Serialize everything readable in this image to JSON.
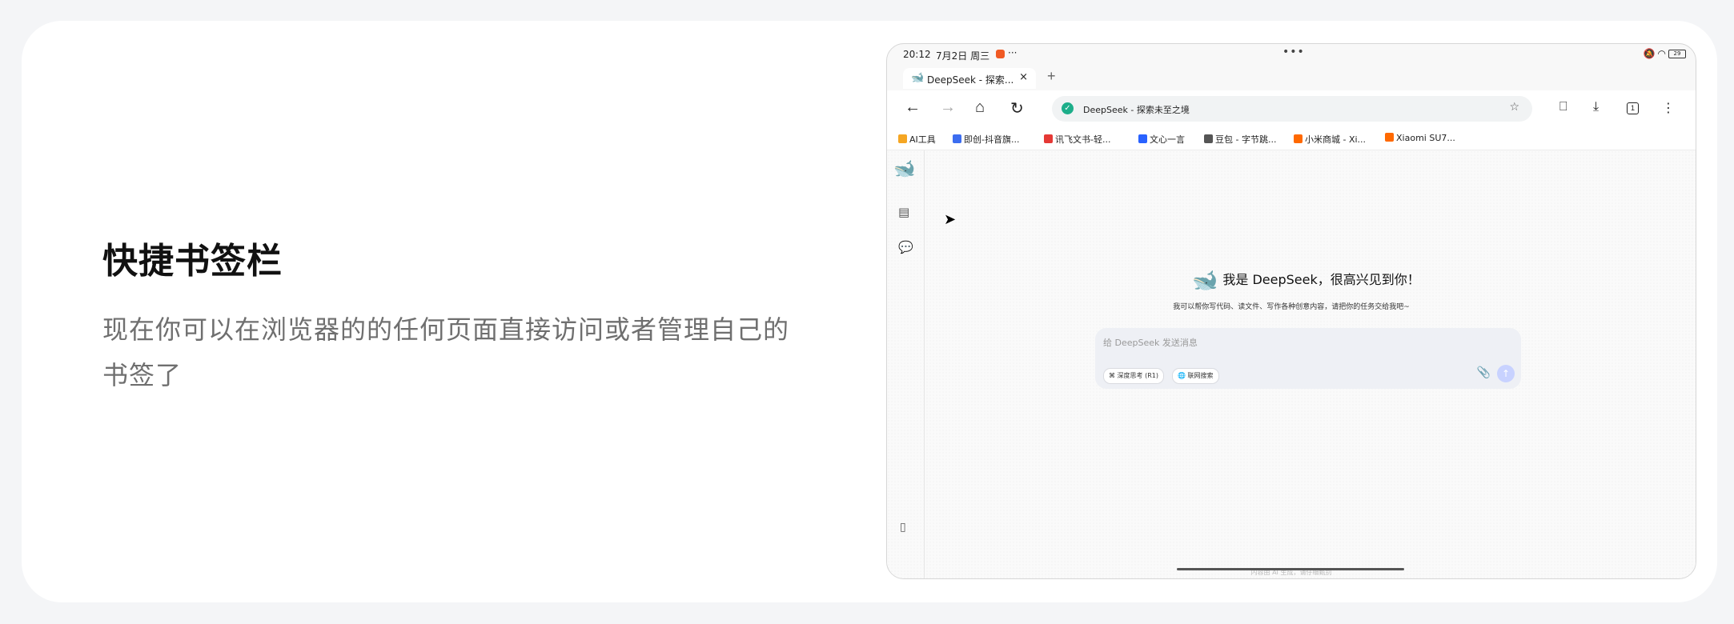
{
  "feature": {
    "title": "快捷书签栏",
    "description_line1": "现在你可以在浏览器的的任何页面直接访问或者管理自己的",
    "description_line2": "书签了"
  },
  "statusbar": {
    "time": "20:12",
    "date": "7月2日 周三",
    "more": "···",
    "center_dots": "•••",
    "battery": "29"
  },
  "tab": {
    "favicon": "deepseek-icon",
    "label": "DeepSeek - 探索...",
    "close": "×",
    "new_tab": "+"
  },
  "navbar": {
    "back": "←",
    "forward": "→",
    "home": "⌂",
    "refresh": "↻",
    "url": "DeepSeek - 探索未至之境",
    "bookmark_add": "☆",
    "bookmarks": "🔖",
    "download": "⤓",
    "tab_count": "1",
    "menu": "⋮"
  },
  "bookmarks": [
    {
      "label": "AI工具",
      "color": "#f5a623"
    },
    {
      "label": "即创-抖音旗...",
      "color": "#3c6df0"
    },
    {
      "label": "讯飞文书-轻...",
      "color": "#e53935"
    },
    {
      "label": "文心一言",
      "color": "#2962ff"
    },
    {
      "label": "豆包 - 字节跳...",
      "color": "#555555"
    },
    {
      "label": "小米商城 - Xi...",
      "color": "#ff6900"
    },
    {
      "label": "Xiaomi SU7...",
      "color": "#ff6900"
    }
  ],
  "deepseek": {
    "greeting": "我是 DeepSeek，很高兴见到你！",
    "subtitle": "我可以帮你写代码、读文件、写作各种创意内容，请把你的任务交给我吧~",
    "placeholder": "给 DeepSeek 发送消息",
    "chip_deepthink": "深度思考 (R1)",
    "chip_search": "联网搜索",
    "footer": "内容由 AI 生成，请仔细甄别"
  },
  "colors": {
    "accent": "#4d6bfe",
    "card": "#ffffff",
    "page_bg": "#f4f5f7"
  }
}
